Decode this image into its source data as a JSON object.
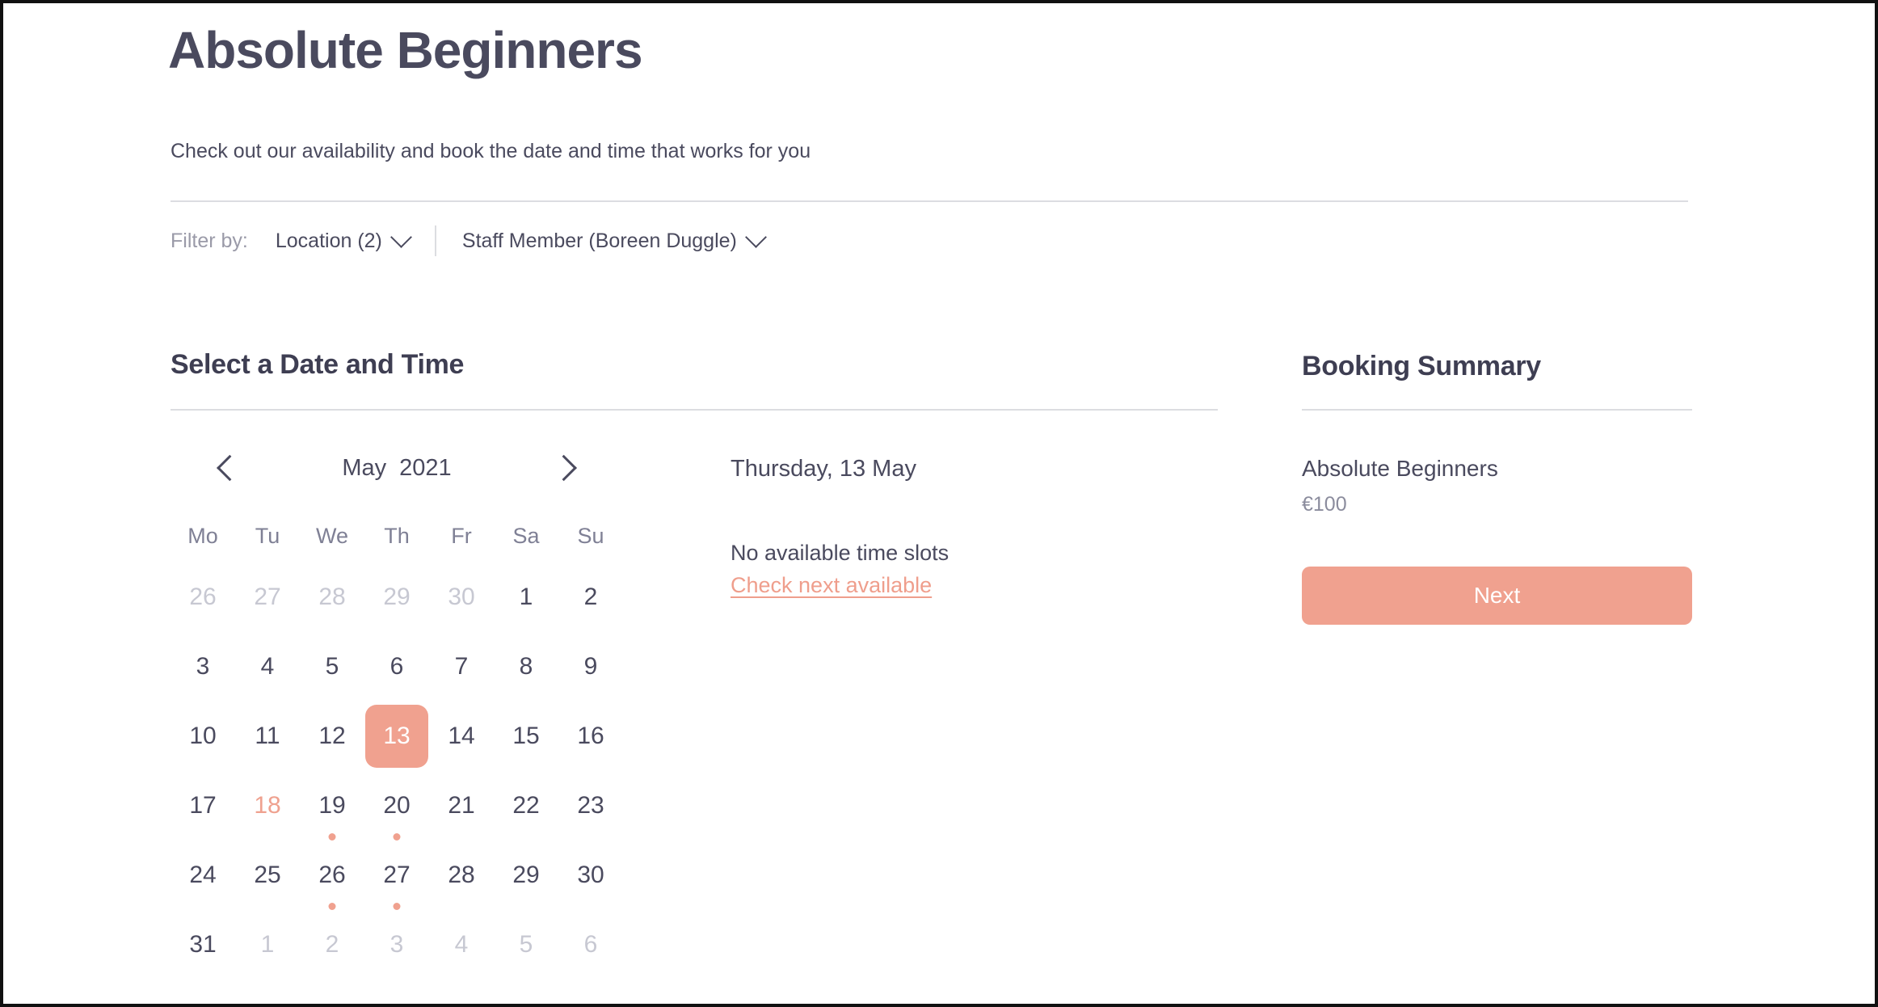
{
  "header": {
    "title": "Absolute Beginners",
    "subtitle": "Check out our availability and book the date and time that works for you"
  },
  "filters": {
    "label": "Filter by:",
    "items": [
      {
        "label": "Location (2)",
        "icon": "chevron-down-icon"
      },
      {
        "label": "Staff Member (Boreen Duggle)",
        "icon": "chevron-down-icon"
      }
    ]
  },
  "calendar_section": {
    "title": "Select a Date and Time",
    "month": "May",
    "year": "2021",
    "prev_icon": "chevron-left-icon",
    "next_icon": "chevron-right-icon",
    "weekdays": [
      "Mo",
      "Tu",
      "We",
      "Th",
      "Fr",
      "Sa",
      "Su"
    ],
    "weeks": [
      [
        {
          "day": "26",
          "state": "muted",
          "dot": false
        },
        {
          "day": "27",
          "state": "muted",
          "dot": false
        },
        {
          "day": "28",
          "state": "muted",
          "dot": false
        },
        {
          "day": "29",
          "state": "muted",
          "dot": false
        },
        {
          "day": "30",
          "state": "muted",
          "dot": false
        },
        {
          "day": "1",
          "state": "normal",
          "dot": false
        },
        {
          "day": "2",
          "state": "normal",
          "dot": false
        }
      ],
      [
        {
          "day": "3",
          "state": "normal",
          "dot": false
        },
        {
          "day": "4",
          "state": "normal",
          "dot": false
        },
        {
          "day": "5",
          "state": "normal",
          "dot": false
        },
        {
          "day": "6",
          "state": "normal",
          "dot": false
        },
        {
          "day": "7",
          "state": "normal",
          "dot": false
        },
        {
          "day": "8",
          "state": "normal",
          "dot": false
        },
        {
          "day": "9",
          "state": "normal",
          "dot": false
        }
      ],
      [
        {
          "day": "10",
          "state": "normal",
          "dot": false
        },
        {
          "day": "11",
          "state": "normal",
          "dot": false
        },
        {
          "day": "12",
          "state": "normal",
          "dot": false
        },
        {
          "day": "13",
          "state": "selected",
          "dot": false
        },
        {
          "day": "14",
          "state": "normal",
          "dot": false
        },
        {
          "day": "15",
          "state": "normal",
          "dot": false
        },
        {
          "day": "16",
          "state": "normal",
          "dot": false
        }
      ],
      [
        {
          "day": "17",
          "state": "normal",
          "dot": false
        },
        {
          "day": "18",
          "state": "today",
          "dot": false
        },
        {
          "day": "19",
          "state": "normal",
          "dot": true
        },
        {
          "day": "20",
          "state": "normal",
          "dot": true
        },
        {
          "day": "21",
          "state": "normal",
          "dot": false
        },
        {
          "day": "22",
          "state": "normal",
          "dot": false
        },
        {
          "day": "23",
          "state": "normal",
          "dot": false
        }
      ],
      [
        {
          "day": "24",
          "state": "normal",
          "dot": false
        },
        {
          "day": "25",
          "state": "normal",
          "dot": false
        },
        {
          "day": "26",
          "state": "normal",
          "dot": true
        },
        {
          "day": "27",
          "state": "normal",
          "dot": true
        },
        {
          "day": "28",
          "state": "normal",
          "dot": false
        },
        {
          "day": "29",
          "state": "normal",
          "dot": false
        },
        {
          "day": "30",
          "state": "normal",
          "dot": false
        }
      ],
      [
        {
          "day": "31",
          "state": "normal",
          "dot": false
        },
        {
          "day": "1",
          "state": "muted",
          "dot": false
        },
        {
          "day": "2",
          "state": "muted",
          "dot": false
        },
        {
          "day": "3",
          "state": "muted",
          "dot": false
        },
        {
          "day": "4",
          "state": "muted",
          "dot": false
        },
        {
          "day": "5",
          "state": "muted",
          "dot": false
        },
        {
          "day": "6",
          "state": "muted",
          "dot": false
        }
      ]
    ]
  },
  "timeslots": {
    "selected_date": "Thursday, 13 May",
    "empty_message": "No available time slots",
    "check_next_link": "Check next available"
  },
  "summary": {
    "title": "Booking Summary",
    "service": "Absolute Beginners",
    "price": "€100",
    "next_label": "Next"
  },
  "colors": {
    "accent": "#F0A18F",
    "text": "#4A4A5E",
    "muted": "#C7C8D2",
    "divider": "#DCDDE1",
    "link": "#EF9E8C"
  }
}
